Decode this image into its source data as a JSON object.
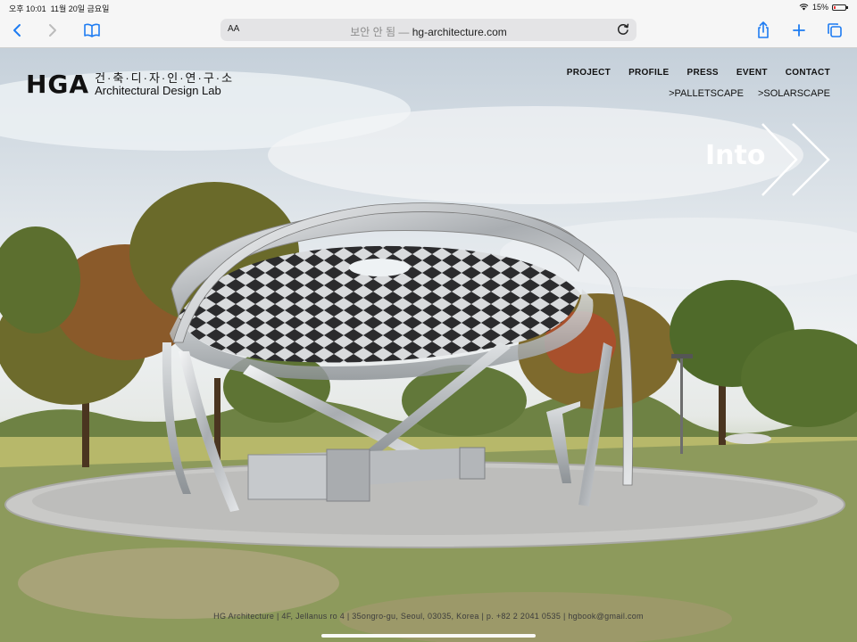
{
  "status_bar": {
    "time": "오후 10:01",
    "date": "11월 20일 금요일",
    "wifi_icon": "wifi-icon",
    "battery": "15%",
    "battery_level": 0.15
  },
  "toolbar": {
    "back_icon": "chevron-left-icon",
    "forward_icon": "chevron-right-icon",
    "bookmarks_icon": "book-icon",
    "reader_label": "AA",
    "security_label": "보안 안 됨 —",
    "url": "hg-architecture.com",
    "reload_icon": "reload-icon",
    "share_icon": "share-icon",
    "new_tab_icon": "plus-icon",
    "tabs_icon": "tabs-icon",
    "accent": "#1e7cf2"
  },
  "site": {
    "logo_mark": "HGA",
    "logo_korean": "건·축·디·자·인·연·구·소",
    "logo_english": "Architectural Design Lab",
    "nav": [
      {
        "label": "PROJECT"
      },
      {
        "label": "PROFILE"
      },
      {
        "label": "PRESS"
      },
      {
        "label": "EVENT"
      },
      {
        "label": "CONTACT"
      }
    ],
    "subnav": [
      {
        "label": ">PALLETSCAPE"
      },
      {
        "label": ">SOLARSCAPE"
      }
    ],
    "into_label": "Into",
    "into_icon": "double-chevron-right-icon",
    "footer": "HG Architecture | 4F, Jellanus ro 4 | 35ongro-gu, Seoul, 03035, Korea | p. +82 2 2041 0535 | hgbook@gmail.com"
  }
}
